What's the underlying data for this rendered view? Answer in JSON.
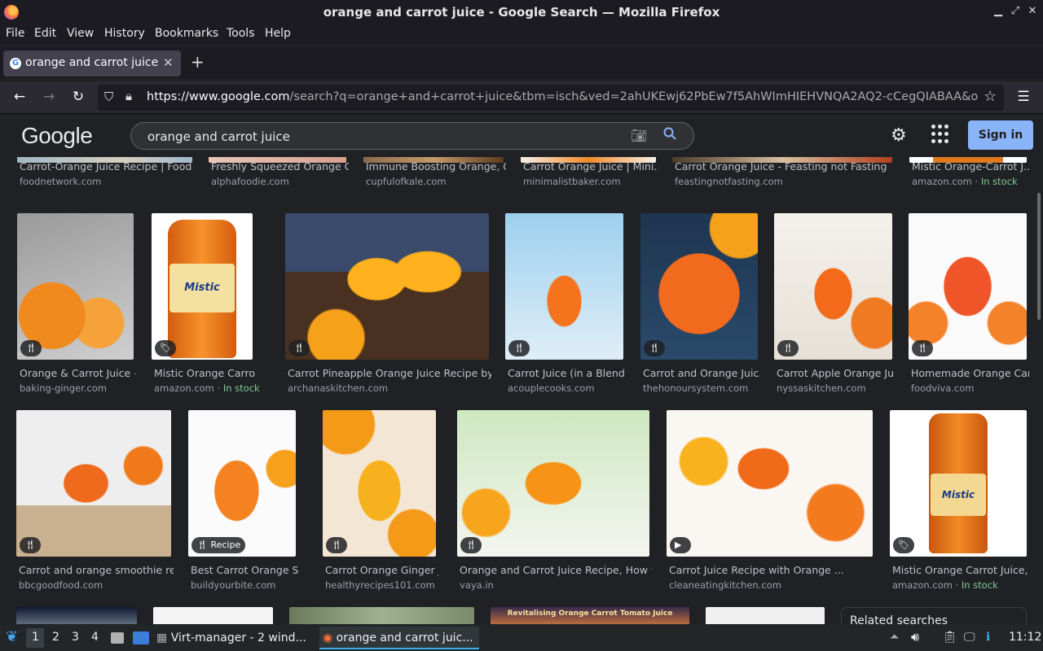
{
  "window": {
    "title": "orange and carrot juice - Google Search — Mozilla Firefox"
  },
  "menu": [
    "File",
    "Edit",
    "View",
    "History",
    "Bookmarks",
    "Tools",
    "Help"
  ],
  "tab": {
    "label": "orange and carrot juice - Google"
  },
  "url": {
    "host": "https://www.google.com",
    "path": "/search?q=orange+and+carrot+juice&tbm=isch&ved=2ahUKEwj62PbEw7f5AhWImHIEHVNQA2AQ2-cCegQIABAA&oq=or"
  },
  "google": {
    "logo": "Google",
    "query": "orange and carrot juice",
    "signin": "Sign in"
  },
  "rows": [
    [
      {
        "title": "Carrot-Orange Juice Recipe | Food ...",
        "source": "foodnetwork.com"
      },
      {
        "title": "Freshly Squeezed Orange C...",
        "source": "alphafoodie.com"
      },
      {
        "title": "Immune Boosting Orange, C...",
        "source": "cupfulofkale.com"
      },
      {
        "title": "Carrot Orange Juice | Mini...",
        "source": "minimalistbaker.com"
      },
      {
        "title": "Carrot Orange Juice - Feasting not Fasting",
        "source": "feastingnotfasting.com"
      },
      {
        "title": "Mistic Orange-Carrot J...",
        "source": "amazon.com",
        "stock": "In stock"
      }
    ],
    [
      {
        "title": "Orange & Carrot Juice {...",
        "source": "baking-ginger.com"
      },
      {
        "title": "Mistic Orange Carrot J...",
        "source": "amazon.com",
        "stock": "In stock"
      },
      {
        "title": "Carrot Pineapple Orange Juice Recipe by ...",
        "source": "archanaskitchen.com"
      },
      {
        "title": "Carrot Juice (in a Blend...",
        "source": "acouplecooks.com"
      },
      {
        "title": "Carrot and Orange Juic...",
        "source": "thehonoursystem.com"
      },
      {
        "title": "Carrot Apple Orange Ju...",
        "source": "nyssaskitchen.com"
      },
      {
        "title": "Homemade Orange Car...",
        "source": "foodviva.com"
      }
    ],
    [
      {
        "title": "Carrot and orange smoothie re...",
        "source": "bbcgoodfood.com"
      },
      {
        "title": "Best Carrot Orange Sm...",
        "source": "buildyourbite.com",
        "badge": "Recipe"
      },
      {
        "title": "Carrot Orange Ginger J...",
        "source": "healthyrecipes101.com"
      },
      {
        "title": "Orange and Carrot Juice Recipe, How to...",
        "source": "vaya.in"
      },
      {
        "title": "Carrot Juice Recipe with Orange ...",
        "source": "cleaneatingkitchen.com"
      },
      {
        "title": "Mistic Orange Carrot Juice, ...",
        "source": "amazon.com",
        "stock": "In stock"
      }
    ]
  ],
  "partial": {
    "banner": "Revitalising Orange Carrot Tomato Juice",
    "related": "Related searches"
  },
  "taskbar": {
    "workspaces": [
      "1",
      "2",
      "3",
      "4"
    ],
    "task1": "Virt-manager - 2 wind...",
    "task2": "orange and carrot juic...",
    "time": "11:12"
  },
  "colors": {
    "accent": "#8ab4f8",
    "stock": "#81c995",
    "bg": "#202124"
  }
}
